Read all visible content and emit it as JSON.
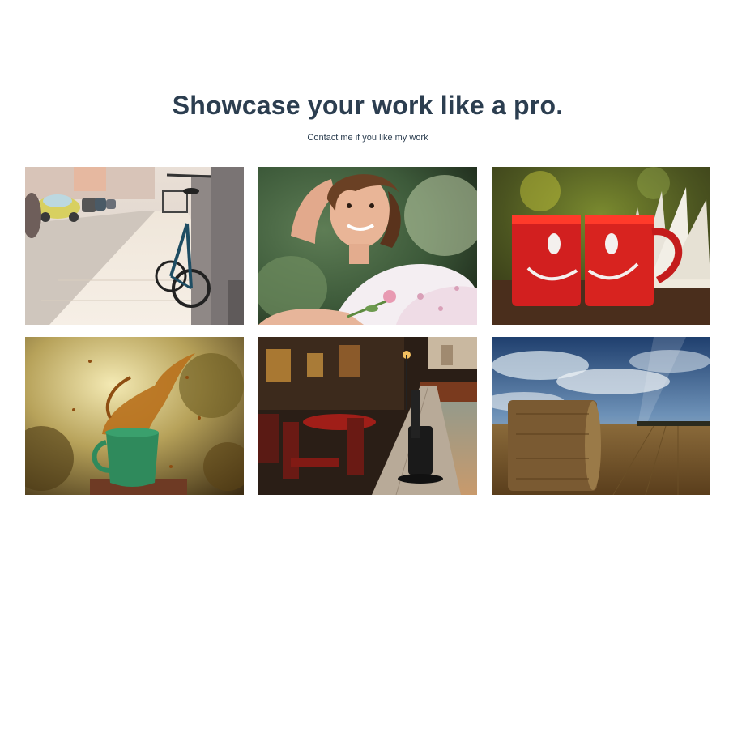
{
  "hero": {
    "title": "Showcase your work like a pro.",
    "subtitle": "Contact me if you like my work"
  },
  "gallery": {
    "items": [
      {
        "subject": "bicycle-street-photo"
      },
      {
        "subject": "smiling-woman-portrait-photo"
      },
      {
        "subject": "red-smiley-mugs-photo"
      },
      {
        "subject": "green-cup-splash-photo"
      },
      {
        "subject": "waterfront-cafe-photo"
      },
      {
        "subject": "hay-bale-field-photo"
      }
    ]
  },
  "colors": {
    "text": "#2c3e50",
    "background": "#ffffff"
  }
}
